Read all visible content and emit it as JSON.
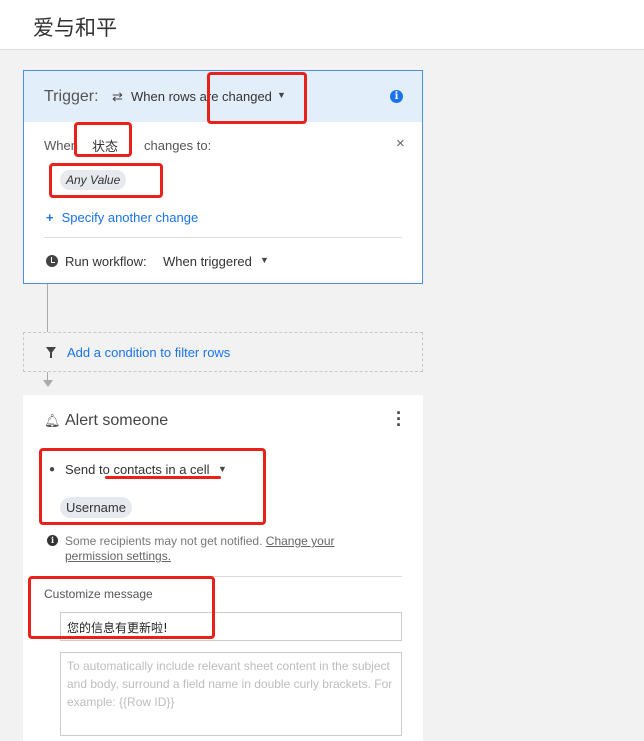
{
  "header": {
    "title": "爱与和平"
  },
  "trigger": {
    "label": "Trigger:",
    "selected": "When rows are changed",
    "info_icon": "i",
    "when_label": "When",
    "column": "状态",
    "changes_to_label": "changes to:",
    "close_icon": "×",
    "value_chip": "Any Value",
    "specify_plus": "+",
    "specify_link": "Specify another change",
    "run_label": "Run workflow:",
    "run_value": "When triggered"
  },
  "filter": {
    "link": "Add a condition to filter rows"
  },
  "alert": {
    "title": "Alert someone",
    "send_prefix": "Send to",
    "send_target": "contacts in a cell",
    "recipient_chip": "Username",
    "notice_text": "Some recipients may not get notified.",
    "notice_link_1": "Change your",
    "notice_link_2": "permission settings.",
    "customize_label": "Customize message",
    "message_value": "您的信息有更新啦!",
    "body_placeholder": "To automatically include relevant sheet content in the subject and body, surround a field name in double curly brackets. For example: {{Row ID}}"
  },
  "icons": {
    "swap": "swap-icon",
    "dropdown": "caret-down-icon",
    "info": "info-icon",
    "close": "close-icon",
    "clock": "clock-icon",
    "filter": "funnel-icon",
    "bell": "bell-icon",
    "more": "kebab-menu-icon",
    "person": "person-icon"
  },
  "colors": {
    "accent": "#1a73e8",
    "annotation": "#e8211a",
    "trigger_header": "#e3eefb"
  }
}
